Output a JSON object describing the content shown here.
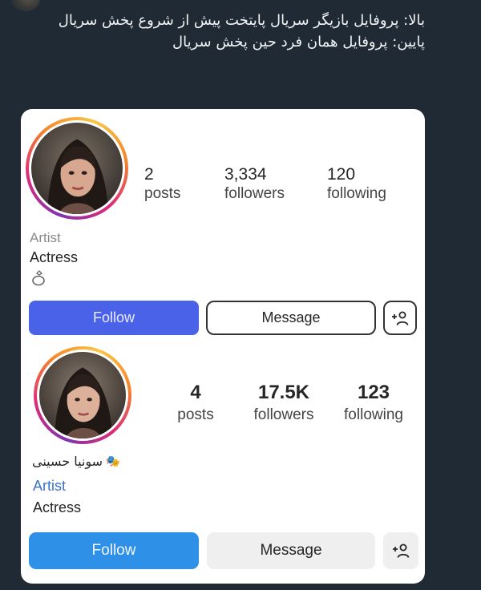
{
  "caption": {
    "line1": "بالا: پروفایل بازیگر سریال پایتخت پیش از شروع پخش سریال",
    "line2": "پایین: پروفایل همان فرد حین پخش سریال"
  },
  "profile_before": {
    "posts_count": "2",
    "posts_label": "posts",
    "followers_count": "3,334",
    "followers_label": "followers",
    "following_count": "120",
    "following_label": "following",
    "category": "Artist",
    "bio": "Actress",
    "bio_icon": "ring-icon",
    "follow_label": "Follow",
    "message_label": "Message",
    "add_user_icon": "add-user-icon"
  },
  "profile_after": {
    "display_name": "سونیا حسینی",
    "name_icon": "theater-masks-emoji",
    "posts_count": "4",
    "posts_label": "posts",
    "followers_count": "17.5K",
    "followers_label": "followers",
    "following_count": "123",
    "following_label": "following",
    "category": "Artist",
    "bio": "Actress",
    "follow_label": "Follow",
    "message_label": "Message",
    "add_user_icon": "add-user-icon"
  },
  "colors": {
    "background": "#1f2a34",
    "follow_old": "#4962e8",
    "follow_new": "#2f90e8",
    "category_new": "#3b73c8"
  }
}
